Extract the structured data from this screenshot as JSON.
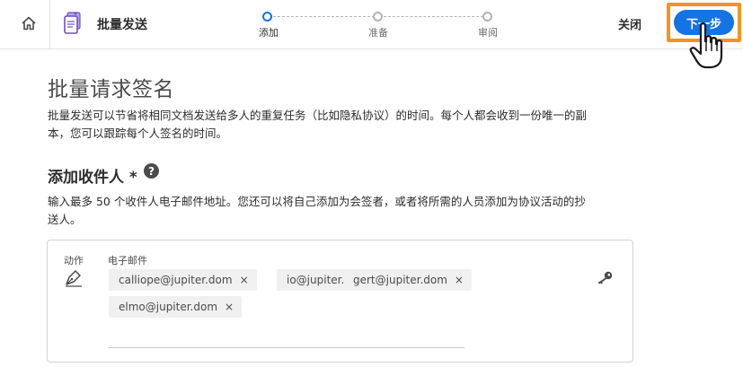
{
  "header": {
    "app_title": "批量发送",
    "close_label": "关闭",
    "next_label": "下一步",
    "icons": {
      "home": "home-icon",
      "app": "bulk-send-icon",
      "cursor": "hand-pointer-cursor"
    }
  },
  "steps": [
    {
      "label": "添加",
      "state": "active"
    },
    {
      "label": "准备",
      "state": "upcoming"
    },
    {
      "label": "审阅",
      "state": "upcoming"
    }
  ],
  "page": {
    "title": "批量请求签名",
    "intro_line1": "批量发送可以节省将相同文档发送给多人的重复任务（比如隐私协议）的时间。每个人都会收到一份唯一的副",
    "intro_line2": "本，您可以跟踪每个人签名的时间。"
  },
  "recipients_section": {
    "title": "添加收件人 *",
    "help": "?",
    "desc_line1": "输入最多 50 个收件人电子邮件地址。您还可以将自己添加为会签者，或者将所需的人员添加为协议活动的抄",
    "desc_line2": "送人。",
    "action_label": "动作",
    "email_label": "电子邮件",
    "chips": [
      {
        "email": "calliope@jupiter.dom",
        "remove": "×"
      },
      {
        "email": "io@jupiter.dom",
        "remove": "×"
      },
      {
        "email": "gert@jupiter.dom",
        "remove": "×"
      },
      {
        "email": "elmo@jupiter.dom",
        "remove": "×"
      }
    ],
    "icons": {
      "action": "pen-icon",
      "auth": "key-icon"
    }
  },
  "colors": {
    "accent": "#1473e6",
    "highlight": "#f29423",
    "chip_bg": "#f0f0f0"
  }
}
